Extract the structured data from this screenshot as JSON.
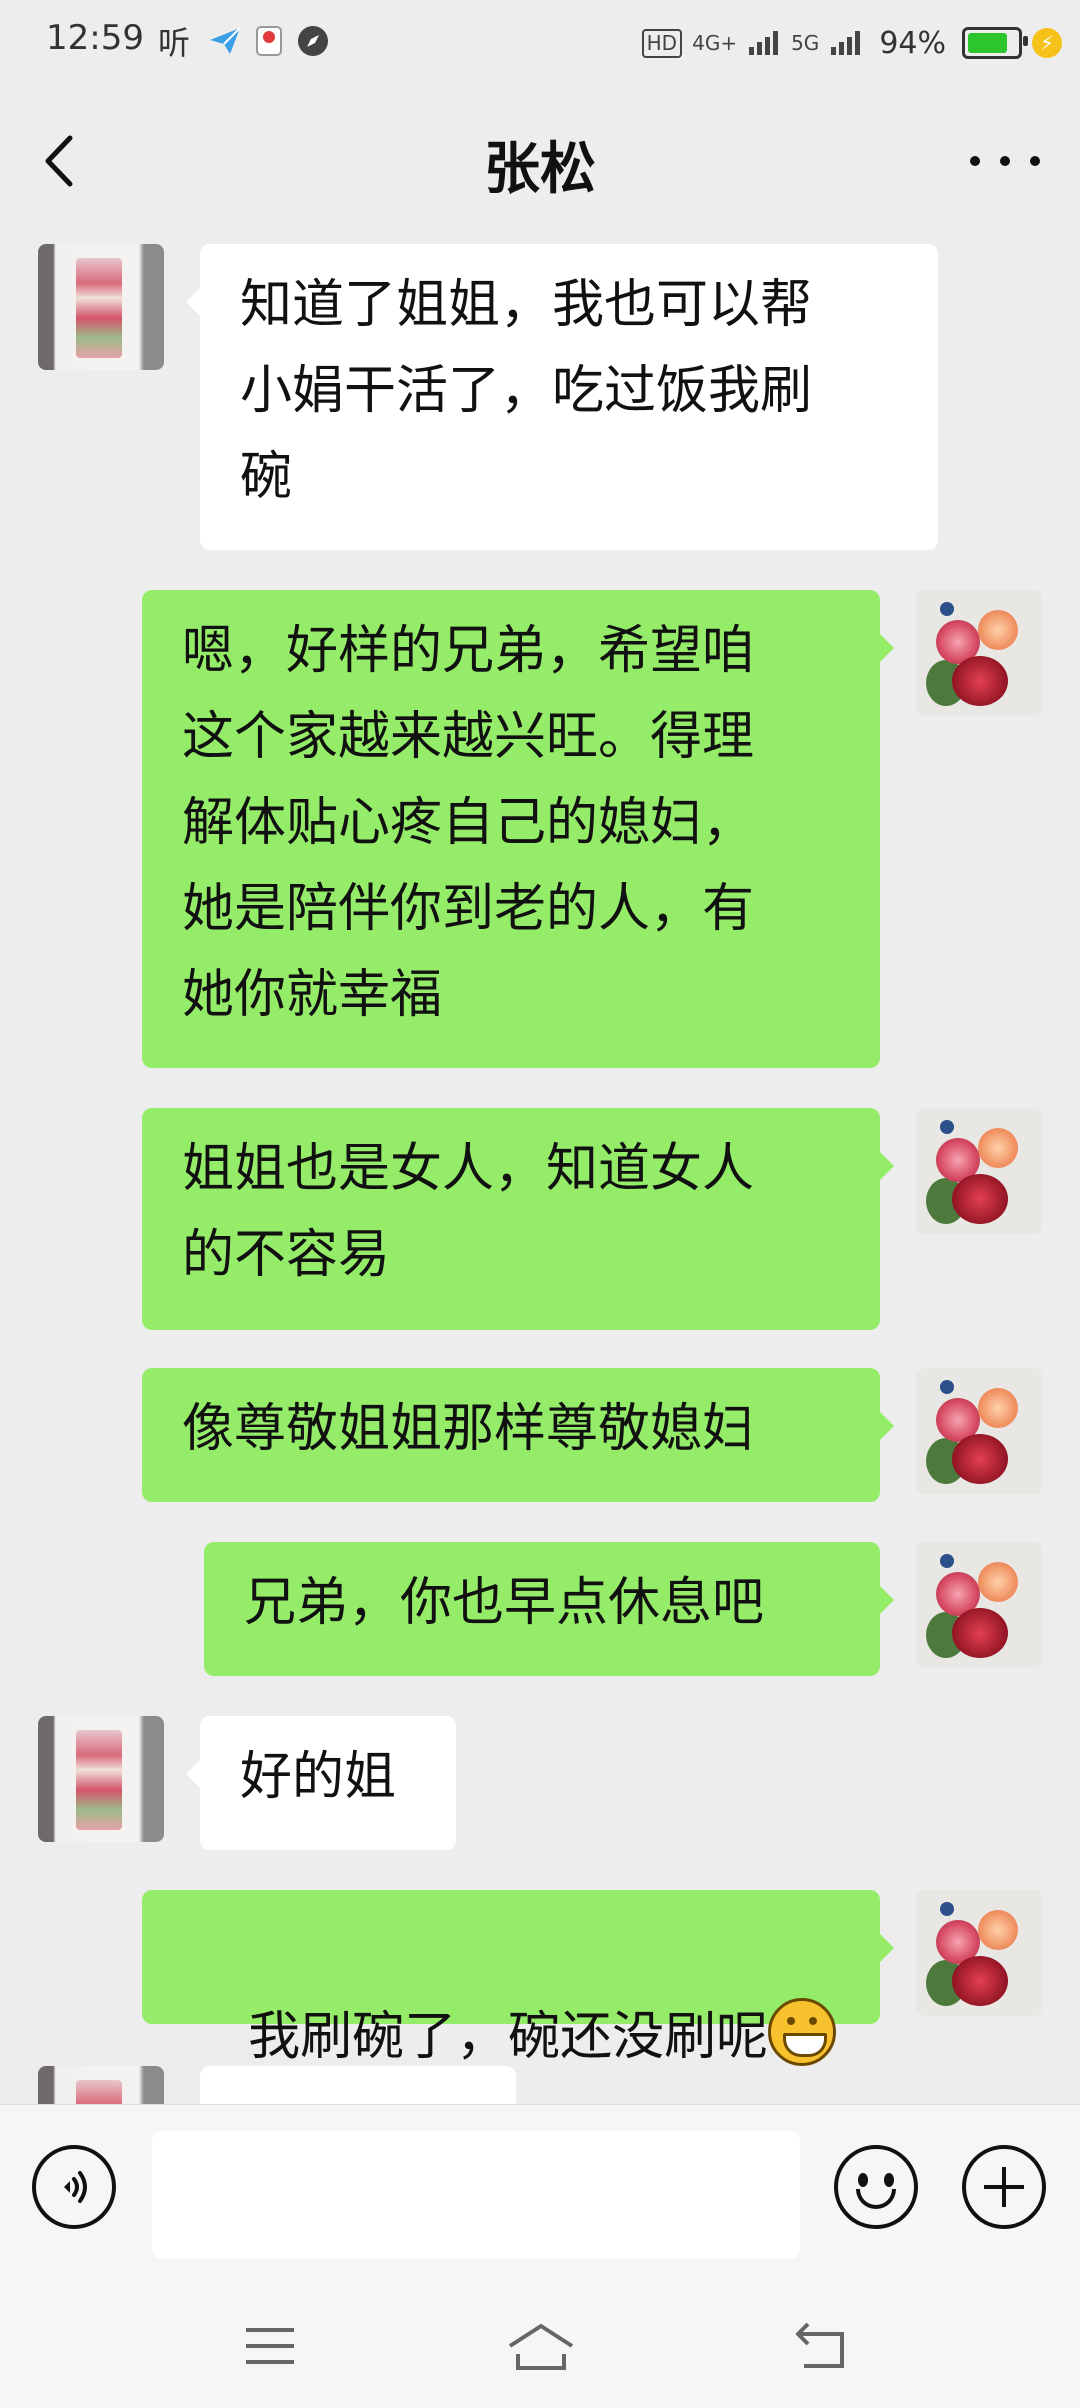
{
  "status_bar": {
    "time": "12:59",
    "ting": "听",
    "hd_label": "HD",
    "net1": "4G+",
    "net2": "5G",
    "battery_percent": "94%",
    "battery_level": 0.94
  },
  "header": {
    "title": "张松"
  },
  "messages": [
    {
      "side": "left",
      "text": "知道了姐姐，我也可以帮\n小娟干活了，吃过饭我刷\n碗"
    },
    {
      "side": "right",
      "text": "嗯，好样的兄弟，希望咱\n这个家越来越兴旺。得理\n解体贴心疼自己的媳妇，\n她是陪伴你到老的人，有\n她你就幸福"
    },
    {
      "side": "right",
      "text": "姐姐也是女人，知道女人\n的不容易"
    },
    {
      "side": "right",
      "text": "像尊敬姐姐那样尊敬媳妇"
    },
    {
      "side": "right",
      "text": "兄弟，你也早点休息吧"
    },
    {
      "side": "left",
      "text": "好的姐"
    },
    {
      "side": "right",
      "text": "我刷碗了，碗还没刷呢",
      "emoji": "grinning-face"
    }
  ],
  "input": {
    "value": "",
    "placeholder": ""
  },
  "icons": {
    "voice": "voice-icon",
    "emoji": "emoji-icon",
    "plus": "plus-icon",
    "nav_menu": "menu-icon",
    "nav_home": "home-icon",
    "nav_back": "back-icon"
  },
  "colors": {
    "bubble_sent": "#95ec69",
    "bubble_received": "#ffffff",
    "background": "#ededed"
  }
}
